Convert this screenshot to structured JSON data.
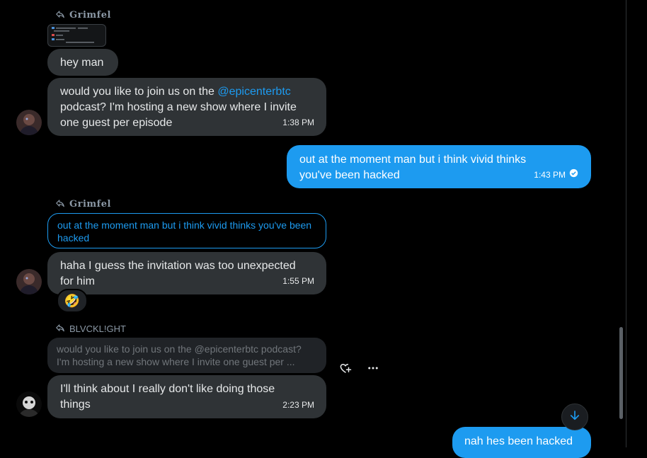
{
  "messages": [
    {
      "reply_label": "Grimfel",
      "type": "incoming_image",
      "text": "hey man"
    },
    {
      "type": "incoming",
      "text_before": "would you like to join us on the ",
      "mention": "@epicenterbtc",
      "text_after_line1": "podcast? I'm hosting a new show where I invite",
      "text_after_line2": "one guest per episode",
      "time": "1:38 PM"
    },
    {
      "type": "outgoing",
      "line1": "out at the moment man but i think vivid thinks",
      "line2": "you've been hacked",
      "time": "1:43 PM"
    },
    {
      "reply_label": "Grimfel",
      "quote": "out at the moment man but i think vivid thinks you've been hacked",
      "type": "incoming",
      "line1": "haha I guess the invitation was too unexpected",
      "line2": "for him",
      "time": "1:55 PM",
      "reaction": "🤣"
    },
    {
      "reply_label": "BLVCKL!GHT",
      "quote_line1": "would you like to join us on the @epicenterbtc podcast?",
      "quote_line2": "I'm hosting a new show where I invite one guest per ...",
      "type": "incoming",
      "line1": "I'll think about I really don't like doing those",
      "line2": "things",
      "time": "2:23 PM"
    },
    {
      "type": "outgoing",
      "line1": "nah hes been hacked"
    }
  ],
  "icons": {
    "reply": "reply-arrow-icon",
    "heart_plus": "heart-plus-icon",
    "more": "more-icon",
    "scroll_down": "arrow-down-icon",
    "read_receipt": "check-circle-icon"
  },
  "colors": {
    "accent": "#1d9bf0",
    "incoming_bubble": "#2f3336",
    "background": "#000000"
  }
}
